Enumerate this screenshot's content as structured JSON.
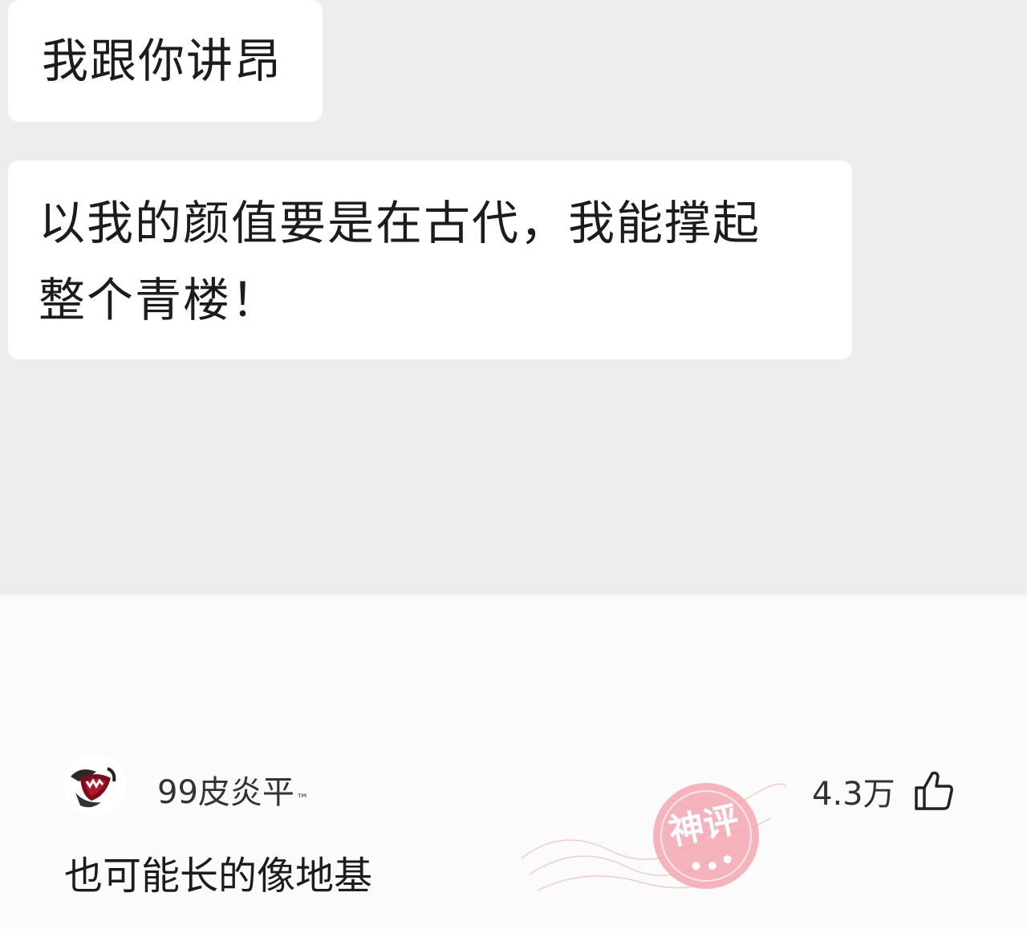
{
  "chat": {
    "messages": [
      {
        "lines": [
          "我跟你讲昂"
        ]
      },
      {
        "lines": [
          "以我的颜值要是在古代，我能撑起",
          "整个青楼！"
        ]
      }
    ]
  },
  "comment": {
    "username": "99皮炎平",
    "username_mark": "™",
    "like_count": "4.3万",
    "text": "也可能长的像地基",
    "stamp_label": "神评",
    "stamp_color": "#e86a7a"
  },
  "icons": {
    "avatar": "avatar-image",
    "like": "thumbs-up-icon",
    "stamp": "god-comment-stamp"
  },
  "colors": {
    "chat_background": "#ededed",
    "bubble": "#ffffff",
    "text": "#1c1c1c"
  }
}
